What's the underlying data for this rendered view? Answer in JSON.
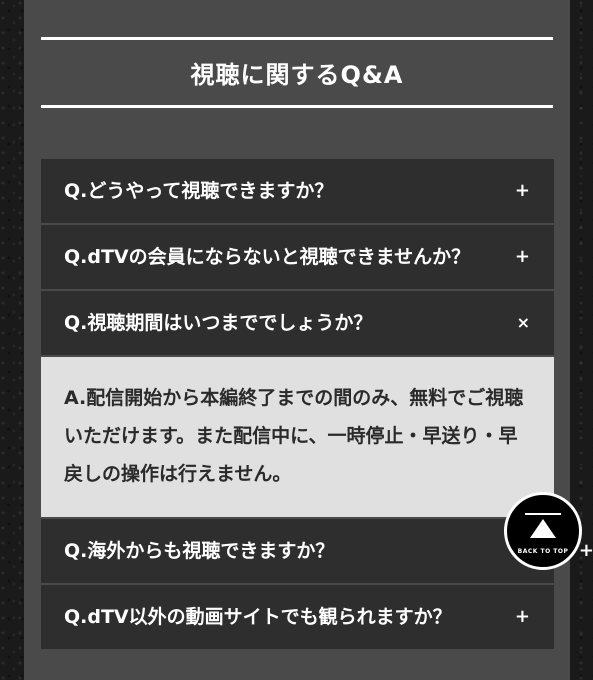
{
  "section": {
    "title": "視聴に関するQ&A"
  },
  "faq": {
    "items": [
      {
        "question": "Q.どうやって視聴できますか？",
        "toggle": "+"
      },
      {
        "question": "Q.dTVの会員にならないと視聴できませんか？",
        "toggle": "+"
      },
      {
        "question": "Q.視聴期間はいつまででしょうか？",
        "toggle": "×"
      },
      {
        "question": "Q.海外からも視聴できますか？",
        "toggle": "+"
      },
      {
        "question": "Q.dTV以外の動画サイトでも観られますか？",
        "toggle": "+"
      }
    ],
    "open_answer": "A.配信開始から本編終了までの間のみ、無料でご視聴いただけます。また配信中に、一時停止・早送り・早戻しの操作は行えません。"
  },
  "back_to_top": {
    "label": "BACK TO TOP"
  },
  "colors": {
    "panel": "#4a4a4a",
    "question_row": "#2e2e2e",
    "answer_bg": "#e0e0e0",
    "text_light": "#ffffff",
    "text_dark": "#2a2a2a"
  }
}
